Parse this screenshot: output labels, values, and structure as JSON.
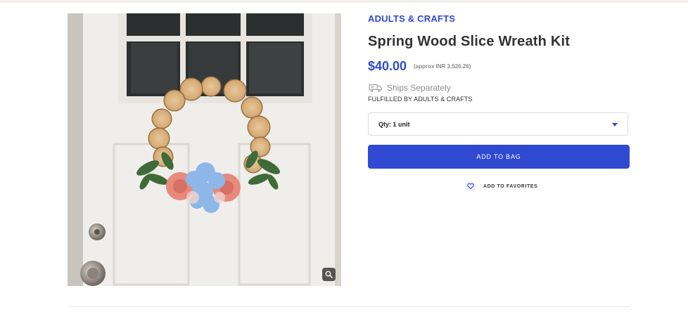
{
  "product": {
    "category": "ADULTS & CRAFTS",
    "title": "Spring Wood Slice Wreath Kit",
    "price": "$40.00",
    "price_approx": "(approx INR 3,526.26)",
    "shipping_text": "Ships Separately",
    "fulfilled_by": "FULFILLED BY ADULTS & CRAFTS",
    "image_alt": "Wood slice wreath with pink and blue flowers on a white door"
  },
  "quantity": {
    "selected": "Qty: 1 unit"
  },
  "actions": {
    "add_to_bag": "ADD TO BAG",
    "add_to_favorites": "ADD TO FAVORITES"
  },
  "icons": {
    "shipping": "truck-icon",
    "favorite": "heart-icon",
    "zoom": "magnifier-icon",
    "dropdown": "caret-down-icon"
  },
  "colors": {
    "accent": "#2f49d1",
    "muted_text": "#8c8c8c"
  }
}
